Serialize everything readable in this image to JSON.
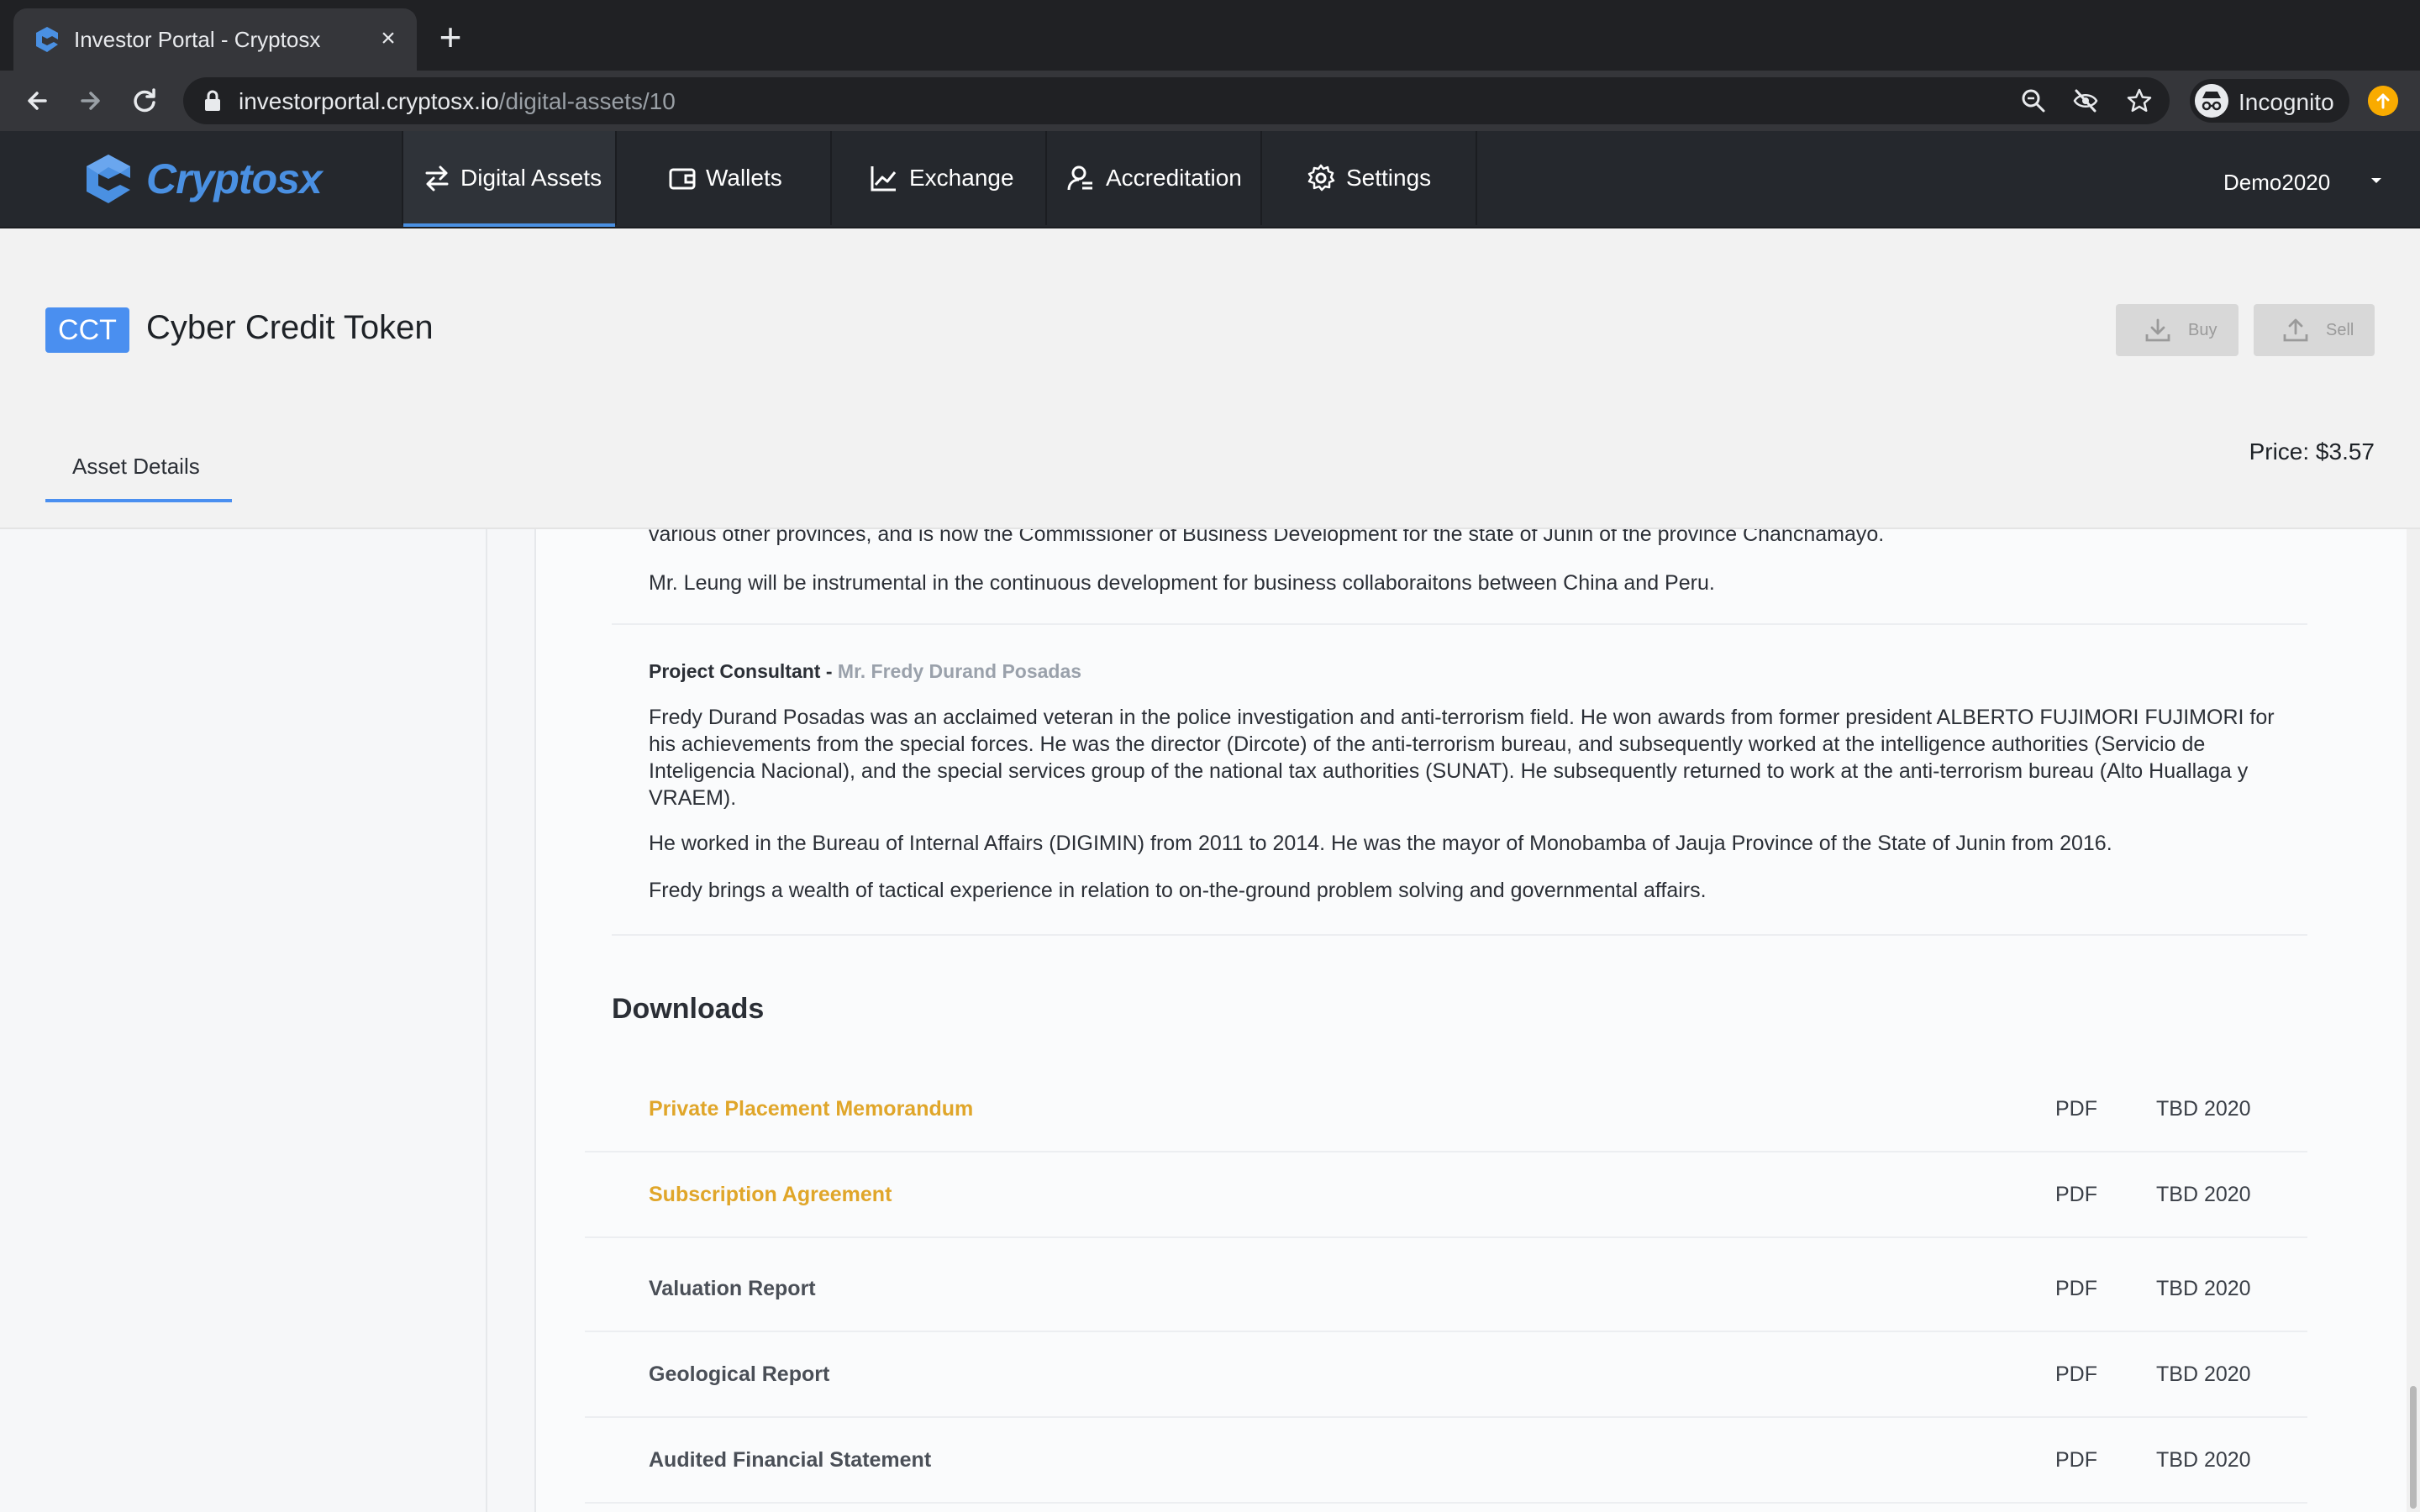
{
  "browser": {
    "tab_title": "Investor Portal - Cryptosx",
    "tab_close": "×",
    "new_tab": "+",
    "url_host": "investorportal.cryptosx.io",
    "url_path": "/digital-assets/10",
    "profile_label": "Incognito"
  },
  "header": {
    "brand": "Cryptosx",
    "nav": [
      {
        "label": "Digital Assets",
        "icon": "transfer-arrows-icon",
        "active": true
      },
      {
        "label": "Wallets",
        "icon": "wallet-icon",
        "active": false
      },
      {
        "label": "Exchange",
        "icon": "chart-line-icon",
        "active": false
      },
      {
        "label": "Accreditation",
        "icon": "user-badge-icon",
        "active": false
      },
      {
        "label": "Settings",
        "icon": "gear-icon",
        "active": false
      }
    ],
    "user": "Demo2020"
  },
  "asset": {
    "ticker": "CCT",
    "name": "Cyber Credit Token",
    "buy_label": "Buy",
    "sell_label": "Sell",
    "tab_label": "Asset Details",
    "price": "Price: $3.57"
  },
  "content": {
    "para_top": "various other provinces, and is now the Commissioner of Business Development for the state of Junin of the province Chanchamayo.",
    "para_leung": "Mr. Leung will be instrumental in the continuous development for business collaboraitons between China and Peru.",
    "consultant_role": "Project Consultant - ",
    "consultant_name": "Mr. Fredy Durand Posadas",
    "para_fredy_1": "Fredy Durand Posadas was an acclaimed veteran in the police investigation and anti-terrorism field. He won awards from former president ALBERTO FUJIMORI FUJIMORI for his achievements from the special forces. He was the director (Dircote) of the anti-terrorism bureau, and subsequently worked at the intelligence authorities (Servicio de Inteligencia Nacional), and the special services group of the national tax authorities (SUNAT). He subsequently returned to work at the anti-terrorism bureau (Alto Huallaga y VRAEM).",
    "para_fredy_2": "He worked in the Bureau of Internal Affairs (DIGIMIN) from 2011 to 2014. He was the mayor of Monobamba of Jauja Province of the State of Junin from 2016.",
    "para_fredy_3": "Fredy brings a wealth of tactical experience in relation to on-the-ground problem solving and governmental affairs."
  },
  "downloads": {
    "title": "Downloads",
    "items": [
      {
        "name": "Private Placement Memorandum",
        "type": "PDF",
        "date": "TBD 2020",
        "link": true
      },
      {
        "name": "Subscription Agreement",
        "type": "PDF",
        "date": "TBD 2020",
        "link": true
      },
      {
        "name": "Valuation Report",
        "type": "PDF",
        "date": "TBD 2020",
        "link": false
      },
      {
        "name": "Geological Report",
        "type": "PDF",
        "date": "TBD 2020",
        "link": false
      },
      {
        "name": "Audited Financial Statement",
        "type": "PDF",
        "date": "TBD 2020",
        "link": false
      }
    ]
  },
  "colors": {
    "accent": "#4a8ff0",
    "link": "#e0a62a",
    "header_bg": "#25282d"
  }
}
